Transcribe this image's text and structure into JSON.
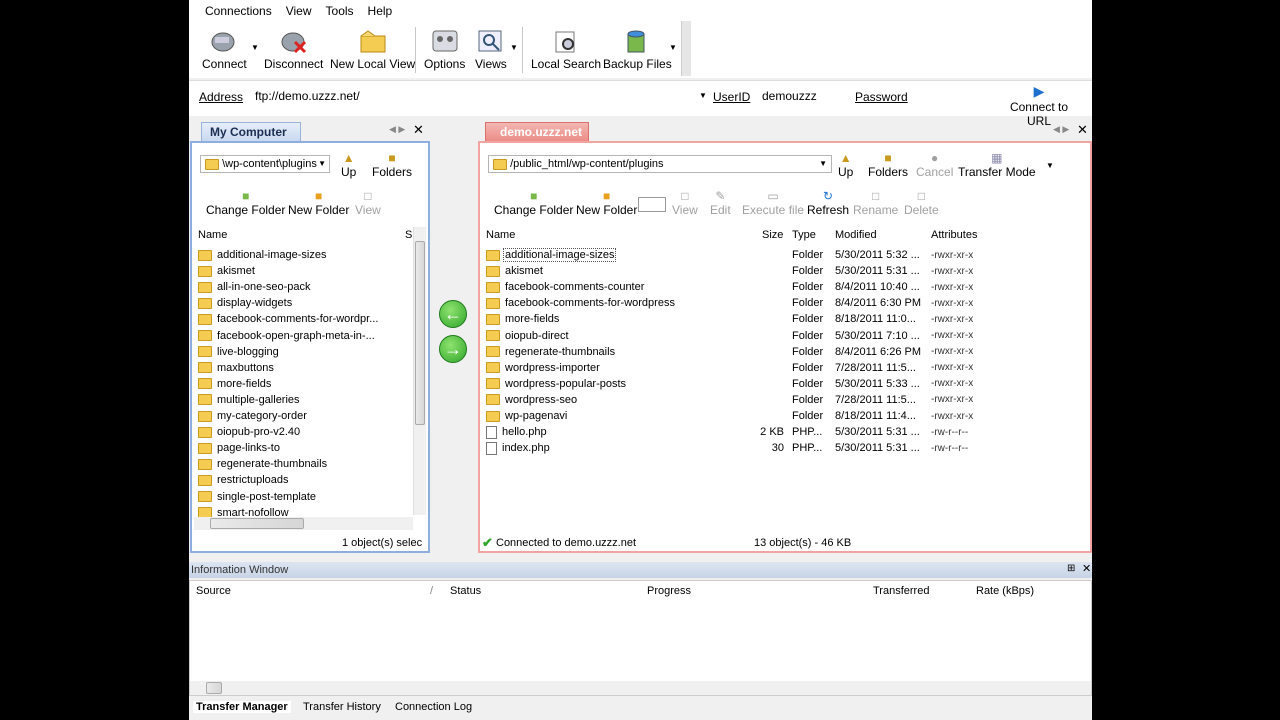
{
  "menu": [
    "Connections",
    "View",
    "Tools",
    "Help"
  ],
  "toolbar": [
    {
      "label": "Connect",
      "icon": "connect-icon"
    },
    {
      "label": "Disconnect",
      "icon": "disconnect-icon"
    },
    {
      "label": "New Local View",
      "icon": "new-local-view-icon"
    },
    {
      "label": "Options",
      "icon": "options-icon"
    },
    {
      "label": "Views",
      "icon": "views-icon"
    },
    {
      "label": "Local Search",
      "icon": "local-search-icon"
    },
    {
      "label": "Backup Files",
      "icon": "backup-files-icon"
    }
  ],
  "address": {
    "label": "Address",
    "value": "ftp://demo.uzzz.net/",
    "userid_label": "UserID",
    "userid": "demouzzz",
    "password_label": "Password",
    "connect_label": "Connect to URL"
  },
  "local": {
    "tab": "My Computer",
    "path": "\\wp-content\\plugins",
    "up": "Up",
    "folders": "Folders",
    "change_folder": "Change Folder",
    "new_folder": "New Folder",
    "view": "View",
    "col_name": "Name",
    "col_s": "S",
    "items": [
      "additional-image-sizes",
      "akismet",
      "all-in-one-seo-pack",
      "display-widgets",
      "facebook-comments-for-wordpr...",
      "facebook-open-graph-meta-in-...",
      "live-blogging",
      "maxbuttons",
      "more-fields",
      "multiple-galleries",
      "my-category-order",
      "oiopub-pro-v2.40",
      "page-links-to",
      "regenerate-thumbnails",
      "restrictuploads",
      "single-post-template",
      "smart-nofollow"
    ],
    "status": "1 object(s) selec"
  },
  "remote": {
    "tab": "demo.uzzz.net",
    "path": "/public_html/wp-content/plugins",
    "up": "Up",
    "folders": "Folders",
    "cancel": "Cancel",
    "transfer_mode": "Transfer Mode",
    "change_folder": "Change Folder",
    "new_folder": "New Folder",
    "view": "View",
    "edit": "Edit",
    "execute": "Execute file",
    "refresh": "Refresh",
    "rename": "Rename",
    "delete": "Delete",
    "columns": [
      "Name",
      "Size",
      "Type",
      "Modified",
      "Attributes"
    ],
    "rows": [
      {
        "name": "additional-image-sizes",
        "size": "",
        "type": "Folder",
        "modified": "5/30/2011 5:32 ...",
        "attr": "-rwxr-xr-x",
        "kind": "folder"
      },
      {
        "name": "akismet",
        "size": "",
        "type": "Folder",
        "modified": "5/30/2011 5:31 ...",
        "attr": "-rwxr-xr-x",
        "kind": "folder"
      },
      {
        "name": "facebook-comments-counter",
        "size": "",
        "type": "Folder",
        "modified": "8/4/2011 10:40 ...",
        "attr": "-rwxr-xr-x",
        "kind": "folder"
      },
      {
        "name": "facebook-comments-for-wordpress",
        "size": "",
        "type": "Folder",
        "modified": "8/4/2011 6:30 PM",
        "attr": "-rwxr-xr-x",
        "kind": "folder"
      },
      {
        "name": "more-fields",
        "size": "",
        "type": "Folder",
        "modified": "8/18/2011 11:0...",
        "attr": "-rwxr-xr-x",
        "kind": "folder"
      },
      {
        "name": "oiopub-direct",
        "size": "",
        "type": "Folder",
        "modified": "5/30/2011 7:10 ...",
        "attr": "-rwxr-xr-x",
        "kind": "folder"
      },
      {
        "name": "regenerate-thumbnails",
        "size": "",
        "type": "Folder",
        "modified": "8/4/2011 6:26 PM",
        "attr": "-rwxr-xr-x",
        "kind": "folder"
      },
      {
        "name": "wordpress-importer",
        "size": "",
        "type": "Folder",
        "modified": "7/28/2011 11:5...",
        "attr": "-rwxr-xr-x",
        "kind": "folder"
      },
      {
        "name": "wordpress-popular-posts",
        "size": "",
        "type": "Folder",
        "modified": "5/30/2011 5:33 ...",
        "attr": "-rwxr-xr-x",
        "kind": "folder"
      },
      {
        "name": "wordpress-seo",
        "size": "",
        "type": "Folder",
        "modified": "7/28/2011 11:5...",
        "attr": "-rwxr-xr-x",
        "kind": "folder"
      },
      {
        "name": "wp-pagenavi",
        "size": "",
        "type": "Folder",
        "modified": "8/18/2011 11:4...",
        "attr": "-rwxr-xr-x",
        "kind": "folder"
      },
      {
        "name": "hello.php",
        "size": "2 KB",
        "type": "PHP...",
        "modified": "5/30/2011 5:31 ...",
        "attr": "-rw-r--r--",
        "kind": "file"
      },
      {
        "name": "index.php",
        "size": "30",
        "type": "PHP...",
        "modified": "5/30/2011 5:31 ...",
        "attr": "-rw-r--r--",
        "kind": "file"
      }
    ],
    "status_connected": "Connected to demo.uzzz.net",
    "status_count": "13 object(s) - 46 KB"
  },
  "info": {
    "title": "Information Window",
    "columns": [
      "Source",
      "Status",
      "Progress",
      "Transferred",
      "Rate (kBps)"
    ],
    "tabs": [
      "Transfer Manager",
      "Transfer History",
      "Connection Log"
    ]
  },
  "colors": {
    "local_accent": "#8eaee0",
    "remote_accent": "#f2a5a0",
    "arrow_green": "#2fa52a"
  }
}
